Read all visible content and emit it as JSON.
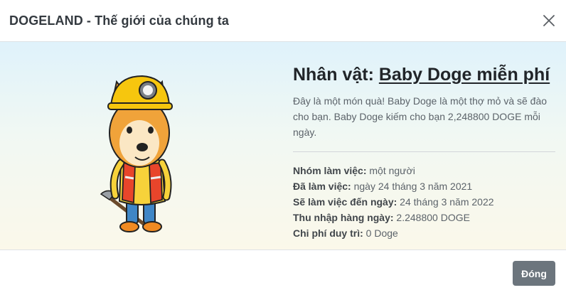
{
  "modal": {
    "title": "DOGELAND - Thế giới của chúng ta",
    "close_button_label": "Đóng"
  },
  "character": {
    "heading_prefix": "Nhân vật: ",
    "name": "Baby Doge miễn phí",
    "description": "Đây là một món quà! Baby Doge là một thợ mỏ và sẽ đào cho bạn. Baby Doge kiếm cho bạn 2,248800 DOGE mỗi ngày.",
    "details": [
      {
        "label": "Nhóm làm việc:",
        "value": " một người"
      },
      {
        "label": "Đã làm việc:",
        "value": " ngày 24 tháng 3 năm 2021"
      },
      {
        "label": "Sẽ làm việc đến ngày:",
        "value": " 24 tháng 3 năm 2022"
      },
      {
        "label": "Thu nhập hàng ngày:",
        "value": " 2.248800 DOGE"
      },
      {
        "label": "Chi phí duy trì:",
        "value": " 0 Doge"
      }
    ]
  },
  "colors": {
    "helmet": "#f6c60e",
    "fur": "#f0a33a",
    "vest": "#e8452b",
    "pants": "#3f86c6",
    "button_bg": "#6c757d"
  },
  "icons": {
    "close": "close-icon",
    "mascot": "doge-miner-image"
  }
}
